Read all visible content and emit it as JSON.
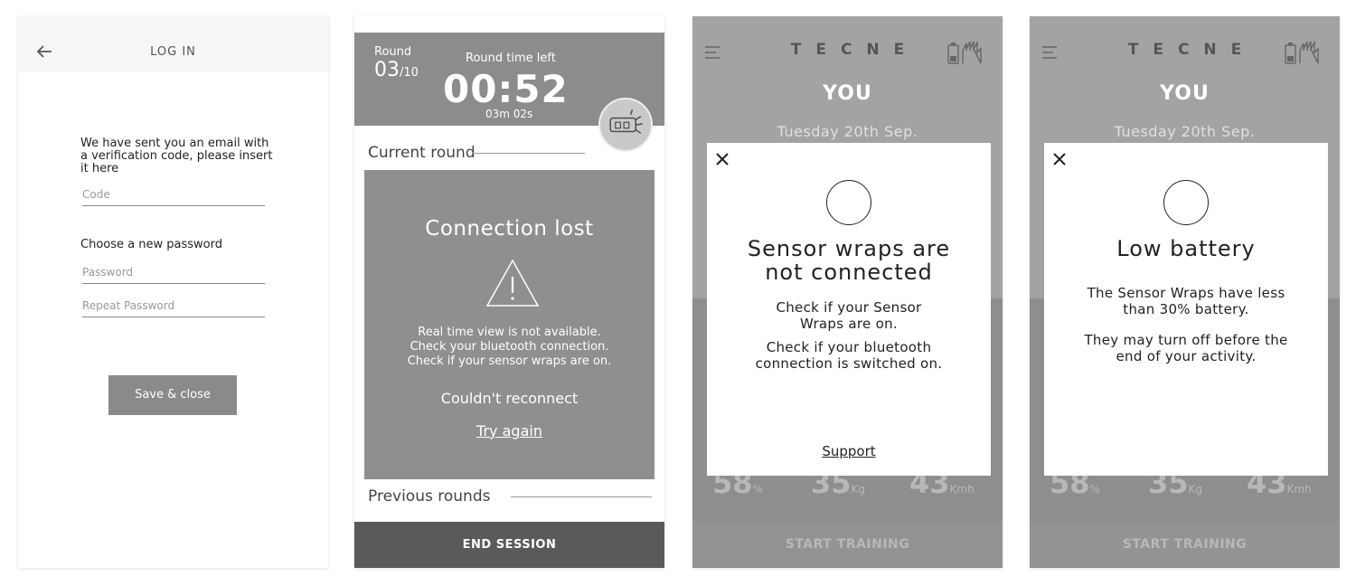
{
  "login_screen": {
    "title": "LOG IN",
    "message": "We have sent you an email with a verification code, please insert it here",
    "code_placeholder": "Code",
    "new_password_label": "Choose a new password",
    "password_placeholder": "Password",
    "repeat_password_placeholder": "Repeat Password",
    "save_button": "Save & close"
  },
  "session_screen": {
    "round_label": "Round",
    "round_current": "03",
    "round_total": "/10",
    "round_time_left_label": "Round time left",
    "timer": "00:52",
    "subtimer": "03m 02s",
    "current_round_label": "Current round",
    "connection_title": "Connection lost",
    "connection_body_1": "Real time view is not available.",
    "connection_body_2": "Check your bluetooth connection.",
    "connection_body_3": "Check if your sensor wraps are on.",
    "couldnt_reconnect": "Couldn't reconnect",
    "try_again": "Try again",
    "previous_rounds_label": "Previous rounds",
    "end_session": "END SESSION"
  },
  "dashboard": {
    "brand": "TECNE",
    "you_label": "YOU",
    "date": "Tuesday 20th Sep.",
    "stat1_value": "58",
    "stat1_unit": "%",
    "stat2_value": "35",
    "stat2_unit": "Kg",
    "stat3_value": "43",
    "stat3_unit": "Kmh",
    "start_training": "START TRAINING"
  },
  "sensor_modal": {
    "title_line1": "Sensor wraps are",
    "title_line2": "not connected",
    "body1_line1": "Check if your Sensor",
    "body1_line2": "Wraps are on.",
    "body2_line1": "Check if your bluetooth",
    "body2_line2": "connection is switched on.",
    "support": "Support"
  },
  "battery_modal": {
    "title": "Low battery",
    "body1_line1": "The Sensor Wraps have less",
    "body1_line2": "than 30% battery.",
    "body2_line1": "They may turn off before the",
    "body2_line2": "end of your activity."
  }
}
